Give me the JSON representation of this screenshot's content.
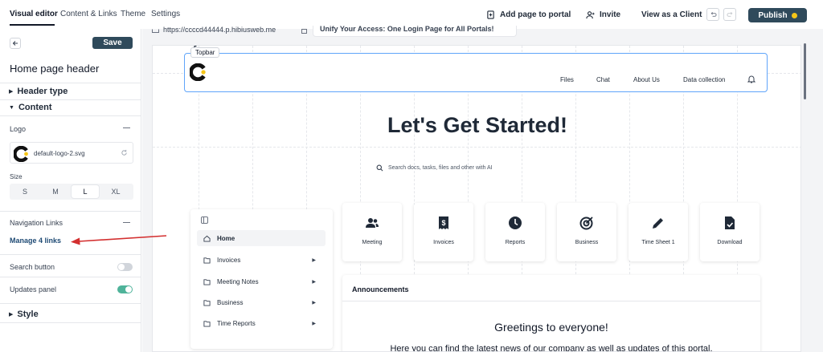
{
  "header": {
    "tabs": [
      "Visual editor",
      "Content & Links",
      "Theme",
      "Settings"
    ],
    "add_page": "Add page to portal",
    "invite": "Invite",
    "view_as_client": "View as a Client",
    "publish": "Publish"
  },
  "panel": {
    "save": "Save",
    "title": "Home page header",
    "header_type": "Header type",
    "content": "Content",
    "logo_label": "Logo",
    "logo_file": "default-logo-2.svg",
    "size_label": "Size",
    "sizes": [
      "S",
      "M",
      "L",
      "XL"
    ],
    "selected_size": "L",
    "nav_links_label": "Navigation Links",
    "manage_links": "Manage 4 links",
    "search_button": "Search button",
    "search_button_on": false,
    "updates_panel": "Updates panel",
    "updates_panel_on": true,
    "style": "Style"
  },
  "canvas": {
    "url_text": "https://ccccd44444.p.hibiusweb.me",
    "page_title_text": "Unify Your Access: One Login Page for All Portals!",
    "topbar_badge": "Topbar",
    "nav_links": [
      "Files",
      "Chat",
      "About Us",
      "Data collection"
    ],
    "hero_title": "Let's Get Started!",
    "search_placeholder": "Search docs, tasks, files and other with AI",
    "side_nav": [
      {
        "label": "Home",
        "active": true,
        "has_children": false
      },
      {
        "label": "Invoices",
        "active": false,
        "has_children": true
      },
      {
        "label": "Meeting Notes",
        "active": false,
        "has_children": true
      },
      {
        "label": "Business",
        "active": false,
        "has_children": true
      },
      {
        "label": "Time Reports",
        "active": false,
        "has_children": true
      }
    ],
    "quick_links": [
      {
        "label": "Meeting",
        "icon": "users-icon"
      },
      {
        "label": "Invoices",
        "icon": "invoice-icon"
      },
      {
        "label": "Reports",
        "icon": "clock-icon"
      },
      {
        "label": "Business",
        "icon": "target-icon"
      },
      {
        "label": "Time Sheet 1",
        "icon": "pencil-icon"
      },
      {
        "label": "Download",
        "icon": "file-download-icon"
      }
    ],
    "announcements_title": "Announcements",
    "greeting": "Greetings to everyone!",
    "greeting_sub": "Here you can find the latest news of our company as well as updates of this portal."
  },
  "colors": {
    "primary": "#2f4a5b",
    "link": "#1e4a74",
    "toggle_on": "#4fb39a",
    "toggle_off": "#d1d5db",
    "publish_dot": "#f5c518",
    "annotation_arrow": "#d32f2f",
    "selection_outline": "#60a5fa"
  }
}
